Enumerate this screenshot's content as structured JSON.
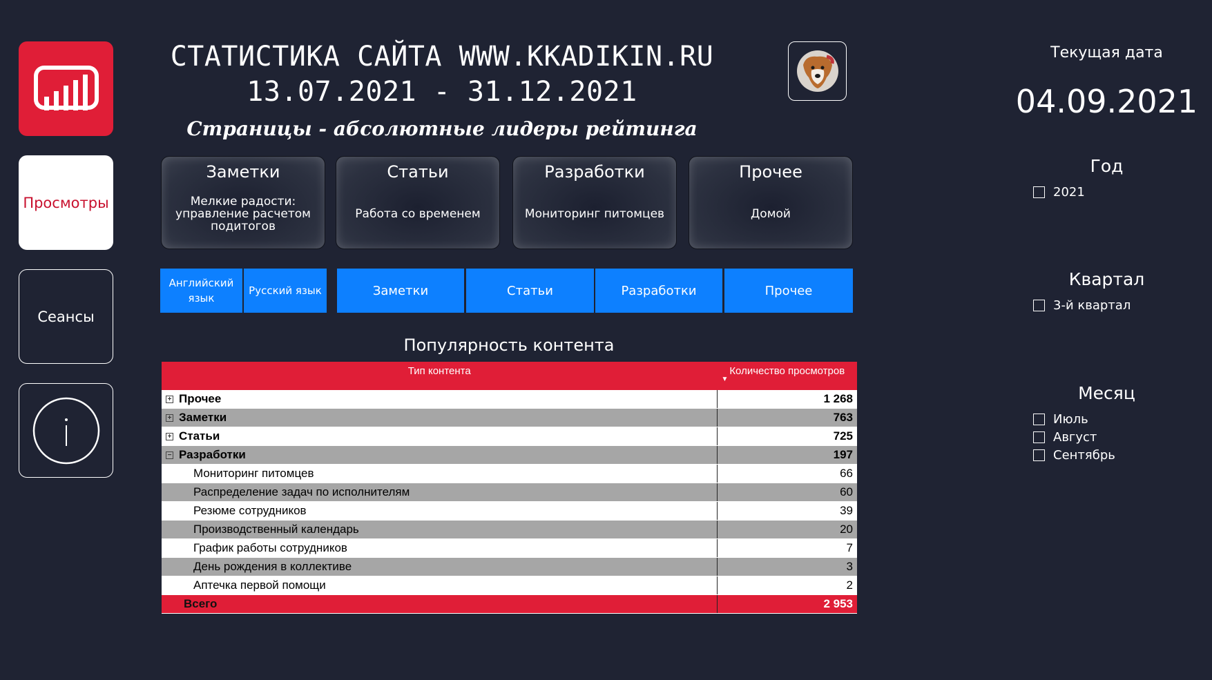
{
  "nav": {
    "views_label": "Просмотры",
    "sessions_label": "Сеансы"
  },
  "header": {
    "title_line1": "СТАТИСТИКА САЙТА WWW.KKADIKIN.RU",
    "title_line2": "13.07.2021 - 31.12.2021",
    "subtitle": "Страницы - абсолютные лидеры рейтинга"
  },
  "cards": [
    {
      "title": "Заметки",
      "text": "Мелкие радости: управление расчетом подитогов"
    },
    {
      "title": "Статьи",
      "text": "Работа со временем"
    },
    {
      "title": "Разработки",
      "text": "Мониторинг питомцев"
    },
    {
      "title": "Прочее",
      "text": "Домой"
    }
  ],
  "buttons": {
    "english": "Английский язык",
    "russian": "Русский язык",
    "notes": "Заметки",
    "articles": "Статьи",
    "developments": "Разработки",
    "other": "Прочее"
  },
  "table": {
    "title": "Популярность контента",
    "col_type": "Тип контента",
    "col_views": "Количество просмотров",
    "rows": [
      {
        "name": "Прочее",
        "value": "1 268"
      },
      {
        "name": "Заметки",
        "value": "763"
      },
      {
        "name": "Статьи",
        "value": "725"
      },
      {
        "name": "Разработки",
        "value": "197"
      }
    ],
    "children": [
      {
        "name": "Мониторинг питомцев",
        "value": "66"
      },
      {
        "name": "Распределение задач по исполнителям",
        "value": "60"
      },
      {
        "name": "Резюме сотрудников",
        "value": "39"
      },
      {
        "name": "Производственный календарь",
        "value": "20"
      },
      {
        "name": "График работы сотрудников",
        "value": "7"
      },
      {
        "name": "День рождения в коллективе",
        "value": "3"
      },
      {
        "name": "Аптечка первой помощи",
        "value": "2"
      }
    ],
    "total_label": "Всего",
    "total_value": "2 953"
  },
  "right_panel": {
    "date_label": "Текущая дата",
    "date_value": "04.09.2021",
    "year_label": "Год",
    "year_options": [
      "2021"
    ],
    "quarter_label": "Квартал",
    "quarter_options": [
      "3-й квартал"
    ],
    "month_label": "Месяц",
    "month_options": [
      "Июль",
      "Август",
      "Сентябрь"
    ]
  },
  "colors": {
    "background": "#1f2333",
    "accent_red": "#e01e37",
    "button_blue": "#0d80ff"
  }
}
